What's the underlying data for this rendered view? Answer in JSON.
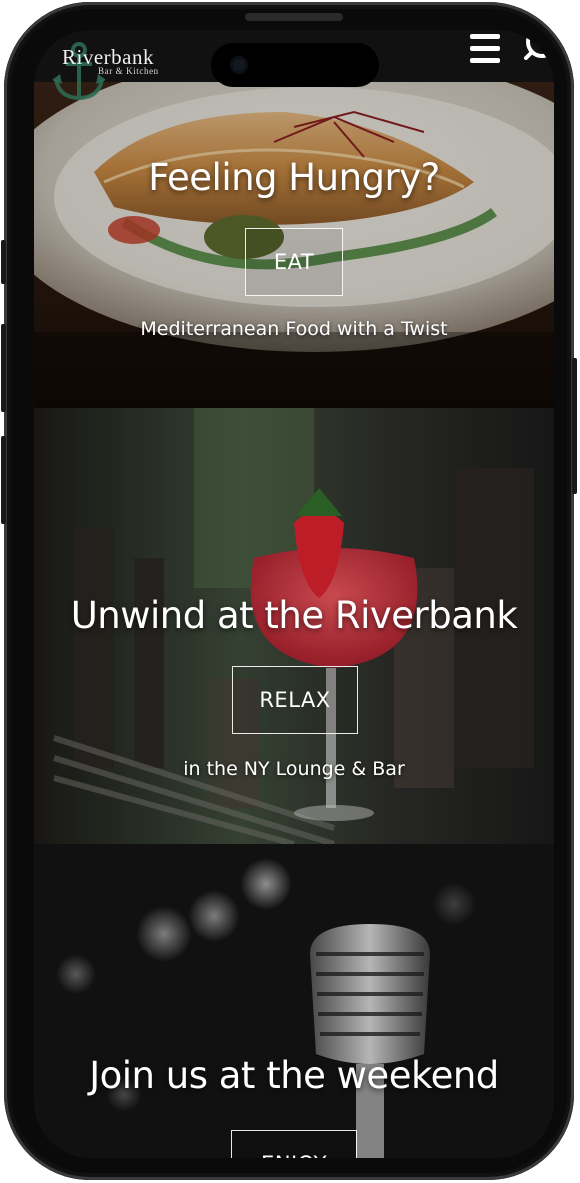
{
  "brand": {
    "name": "Riverbank",
    "subtitle": "Bar & Kitchen",
    "logo_icon": "anchor-icon",
    "accent_color": "#2e6b52"
  },
  "header": {
    "menu_icon": "hamburger-menu-icon",
    "search_icon": "search-icon"
  },
  "sections": [
    {
      "heading": "Feeling Hungry?",
      "button_label": "EAT",
      "tagline": "Mediterranean Food with a Twist",
      "image": "plated-fish-dish"
    },
    {
      "heading": "Unwind at the Riverbank",
      "button_label": "RELAX",
      "tagline": "in the NY Lounge & Bar",
      "image": "strawberry-cocktail"
    },
    {
      "heading": "Join us at the weekend",
      "button_label": "ENJOY",
      "image": "vintage-microphone"
    }
  ]
}
